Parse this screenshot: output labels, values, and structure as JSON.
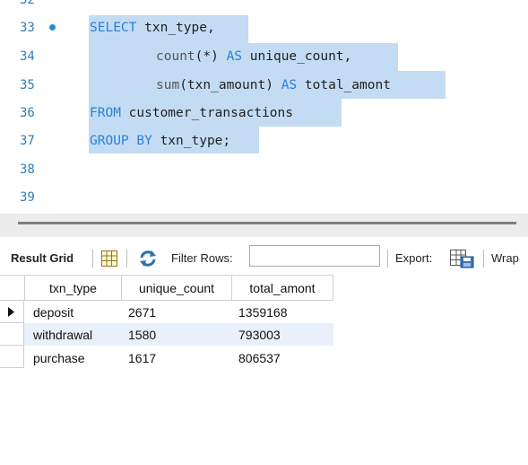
{
  "editor": {
    "line_numbers": [
      "32",
      "33",
      "34",
      "35",
      "36",
      "37",
      "38",
      "39"
    ],
    "code": {
      "l33_kw": "SELECT",
      "l33_rest": " txn_type,",
      "l34_fn": "count",
      "l34_mid": "(*) ",
      "l34_kw": "AS",
      "l34_rest": " unique_count,",
      "l35_fn": "sum",
      "l35_mid": "(txn_amount) ",
      "l35_kw": "AS",
      "l35_rest": " total_amont",
      "l36_kw": "FROM",
      "l36_rest": " customer_transactions",
      "l37_kw": "GROUP BY",
      "l37_rest": " txn_type;"
    }
  },
  "result_toolbar": {
    "result_grid_label": "Result Grid",
    "filter_rows_label": "Filter Rows:",
    "filter_value": "",
    "export_label": "Export:",
    "wrap_label": "Wrap"
  },
  "grid": {
    "columns": [
      "txn_type",
      "unique_count",
      "total_amont"
    ],
    "rows": [
      [
        "deposit",
        "2671",
        "1359168"
      ],
      [
        "withdrawal",
        "1580",
        "793003"
      ],
      [
        "purchase",
        "1617",
        "806537"
      ]
    ]
  },
  "colors": {
    "selection": "#c3dcf3",
    "keyword": "#2a7fd6",
    "line_number": "#2f7fb8",
    "row_highlight": "#e8f0fb"
  }
}
